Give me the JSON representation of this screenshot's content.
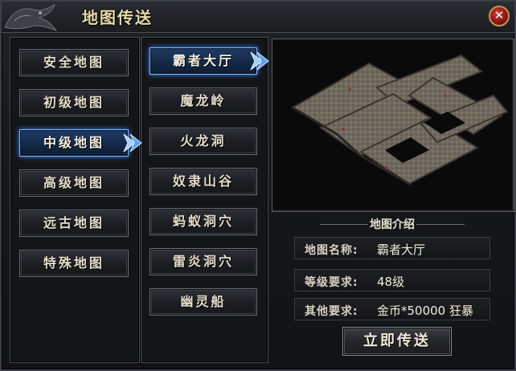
{
  "window": {
    "title": "地图传送",
    "close_label": "✕"
  },
  "categories": [
    {
      "label": "安全地图",
      "active": false
    },
    {
      "label": "初级地图",
      "active": false
    },
    {
      "label": "中级地图",
      "active": true
    },
    {
      "label": "高级地图",
      "active": false
    },
    {
      "label": "远古地图",
      "active": false
    },
    {
      "label": "特殊地图",
      "active": false
    }
  ],
  "maps": [
    {
      "label": "霸者大厅",
      "active": true
    },
    {
      "label": "魔龙岭",
      "active": false
    },
    {
      "label": "火龙洞",
      "active": false
    },
    {
      "label": "奴隶山谷",
      "active": false
    },
    {
      "label": "蚂蚁洞穴",
      "active": false
    },
    {
      "label": "雷炎洞穴",
      "active": false
    },
    {
      "label": "幽灵船",
      "active": false
    }
  ],
  "info": {
    "header": "地图介绍",
    "name_label": "地图名称:",
    "name_value": "霸者大厅",
    "level_label": "等级要求:",
    "level_value": "48级",
    "other_label": "其他要求:",
    "other_value": "金币*50000 狂暴"
  },
  "teleport_button": "立即传送",
  "colors": {
    "active_blue": "#3f8cff",
    "title_gold": "#e8d9a8",
    "close_red": "#c0281c"
  }
}
